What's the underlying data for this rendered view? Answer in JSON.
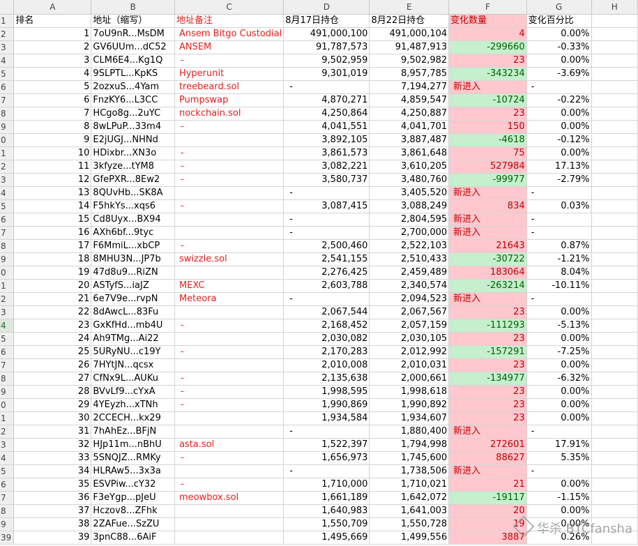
{
  "columns": [
    "A",
    "B",
    "C",
    "D",
    "E",
    "F",
    "G",
    "H"
  ],
  "headers": {
    "rank": "排名",
    "address": "地址（缩写）",
    "note": "地址备注",
    "hold_aug17": "8月17日持仓",
    "hold_aug22": "8月22日持仓",
    "change_qty": "变化数量",
    "change_pct": "变化百分比"
  },
  "row_numbers": [
    "1",
    "2",
    "3",
    "4",
    "5",
    "6",
    "7",
    "8",
    "9",
    "0",
    "1",
    "2",
    "3",
    "4",
    "5",
    "6",
    "7",
    "8",
    "9",
    "0",
    "1",
    "2",
    "3",
    "4",
    "5",
    "6",
    "7",
    "8",
    "9",
    "0",
    "1",
    "2",
    "3",
    "4",
    "5",
    "6",
    "7",
    "8",
    "9",
    "39"
  ],
  "selected_row": "4",
  "rows": [
    {
      "rank": "1",
      "address": "7oU9nR...MsDM",
      "note": "Ansem Bitgo Custodial",
      "aug17": "491,000,100",
      "aug22": "491,000,104",
      "change": "4",
      "change_type": "pos",
      "pct": "0.00%"
    },
    {
      "rank": "2",
      "address": "GV6UUm...dC52",
      "note": "ANSEM",
      "aug17": "91,787,573",
      "aug22": "91,487,913",
      "change": "-299660",
      "change_type": "neg",
      "pct": "-0.33%"
    },
    {
      "rank": "3",
      "address": "CLM6E4...Kg1Q",
      "note": "-",
      "aug17": "9,502,959",
      "aug22": "9,502,982",
      "change": "23",
      "change_type": "pos",
      "pct": "0.00%"
    },
    {
      "rank": "4",
      "address": "9SLPTL...KpKS",
      "note": "Hyperunit",
      "aug17": "9,301,019",
      "aug22": "8,957,785",
      "change": "-343234",
      "change_type": "neg",
      "pct": "-3.69%"
    },
    {
      "rank": "5",
      "address": "2ozxuS...4Yam",
      "note": "treebeard.sol",
      "aug17": "-",
      "aug22": "7,194,277",
      "change": "新进入",
      "change_type": "new",
      "pct": "-"
    },
    {
      "rank": "6",
      "address": "FnzKY6...L3CC",
      "note": "Pumpswap",
      "aug17": "4,870,271",
      "aug22": "4,859,547",
      "change": "-10724",
      "change_type": "neg",
      "pct": "-0.22%"
    },
    {
      "rank": "7",
      "address": "HCgo8g...2uYC",
      "note": "nockchain.sol",
      "aug17": "4,250,864",
      "aug22": "4,250,887",
      "change": "23",
      "change_type": "pos",
      "pct": "0.00%"
    },
    {
      "rank": "8",
      "address": "8wLPuP...33m4",
      "note": "-",
      "aug17": "4,041,551",
      "aug22": "4,041,701",
      "change": "150",
      "change_type": "pos",
      "pct": "0.00%"
    },
    {
      "rank": "9",
      "address": "E2jUGJ...NHNd",
      "note": "",
      "aug17": "3,892,105",
      "aug22": "3,887,487",
      "change": "-4618",
      "change_type": "neg",
      "pct": "-0.12%"
    },
    {
      "rank": "10",
      "address": "HDixbr...XN3o",
      "note": "-",
      "aug17": "3,861,573",
      "aug22": "3,861,648",
      "change": "75",
      "change_type": "pos",
      "pct": "0.00%"
    },
    {
      "rank": "11",
      "address": "3kfyze...tYM8",
      "note": "-",
      "aug17": "3,082,221",
      "aug22": "3,610,205",
      "change": "527984",
      "change_type": "pos",
      "pct": "17.13%"
    },
    {
      "rank": "12",
      "address": "GfePXR...8Ew2",
      "note": "-",
      "aug17": "3,580,737",
      "aug22": "3,480,760",
      "change": "-99977",
      "change_type": "neg",
      "pct": "-2.79%"
    },
    {
      "rank": "13",
      "address": "8QUvHb...SK8A",
      "note": "",
      "aug17": "-",
      "aug22": "3,405,520",
      "change": "新进入",
      "change_type": "new",
      "pct": "-"
    },
    {
      "rank": "14",
      "address": "F5hkYs...xqs6",
      "note": "-",
      "aug17": "3,087,415",
      "aug22": "3,088,249",
      "change": "834",
      "change_type": "pos",
      "pct": "0.03%"
    },
    {
      "rank": "15",
      "address": "Cd8Uyx...BX94",
      "note": "",
      "aug17": "-",
      "aug22": "2,804,595",
      "change": "新进入",
      "change_type": "new",
      "pct": "-"
    },
    {
      "rank": "16",
      "address": "AXh6bf...9tyc",
      "note": "",
      "aug17": "-",
      "aug22": "2,700,000",
      "change": "新进入",
      "change_type": "new",
      "pct": "-"
    },
    {
      "rank": "17",
      "address": "F6MmiL...xbCP",
      "note": "-",
      "aug17": "2,500,460",
      "aug22": "2,522,103",
      "change": "21643",
      "change_type": "pos",
      "pct": "0.87%"
    },
    {
      "rank": "18",
      "address": "8MHU3N...JP7b",
      "note": "swizzle.sol",
      "aug17": "2,541,155",
      "aug22": "2,510,433",
      "change": "-30722",
      "change_type": "neg",
      "pct": "-1.21%"
    },
    {
      "rank": "19",
      "address": "47d8u9...RiZN",
      "note": "",
      "aug17": "2,276,425",
      "aug22": "2,459,489",
      "change": "183064",
      "change_type": "pos",
      "pct": "8.04%"
    },
    {
      "rank": "20",
      "address": "ASTyfS...iaJZ",
      "note": "MEXC",
      "aug17": "2,603,788",
      "aug22": "2,340,574",
      "change": "-263214",
      "change_type": "neg",
      "pct": "-10.11%"
    },
    {
      "rank": "21",
      "address": "6e7V9e...rvpN",
      "note": "Meteora",
      "aug17": "-",
      "aug22": "2,094,523",
      "change": "新进入",
      "change_type": "new",
      "pct": "-"
    },
    {
      "rank": "22",
      "address": "8dAwcL...83Fu",
      "note": "",
      "aug17": "2,067,544",
      "aug22": "2,067,567",
      "change": "23",
      "change_type": "pos",
      "pct": "0.00%"
    },
    {
      "rank": "23",
      "address": "GxKfHd...mb4U",
      "note": "-",
      "aug17": "2,168,452",
      "aug22": "2,057,159",
      "change": "-111293",
      "change_type": "neg",
      "pct": "-5.13%"
    },
    {
      "rank": "24",
      "address": "Ah9TMg...Ai22",
      "note": "",
      "aug17": "2,030,082",
      "aug22": "2,030,105",
      "change": "23",
      "change_type": "pos",
      "pct": "0.00%"
    },
    {
      "rank": "25",
      "address": "5URyNU...c19Y",
      "note": "-",
      "aug17": "2,170,283",
      "aug22": "2,012,992",
      "change": "-157291",
      "change_type": "neg",
      "pct": "-7.25%"
    },
    {
      "rank": "26",
      "address": "7HYtJN...qcsx",
      "note": "",
      "aug17": "2,010,008",
      "aug22": "2,010,031",
      "change": "23",
      "change_type": "pos",
      "pct": "0.00%"
    },
    {
      "rank": "27",
      "address": "CfNx9L...AUKu",
      "note": "-",
      "aug17": "2,135,638",
      "aug22": "2,000,661",
      "change": "-134977",
      "change_type": "neg",
      "pct": "-6.32%"
    },
    {
      "rank": "28",
      "address": "BVvLf9...cYxA",
      "note": "-",
      "aug17": "1,998,595",
      "aug22": "1,998,618",
      "change": "23",
      "change_type": "pos",
      "pct": "0.00%"
    },
    {
      "rank": "29",
      "address": "4YEyzh...xTNh",
      "note": "-",
      "aug17": "1,990,869",
      "aug22": "1,990,892",
      "change": "23",
      "change_type": "pos",
      "pct": "0.00%"
    },
    {
      "rank": "30",
      "address": "2CCECH...kx29",
      "note": "",
      "aug17": "1,934,584",
      "aug22": "1,934,607",
      "change": "23",
      "change_type": "pos",
      "pct": "0.00%"
    },
    {
      "rank": "31",
      "address": "7hAhEz...BFjN",
      "note": "",
      "aug17": "-",
      "aug22": "1,880,400",
      "change": "新进入",
      "change_type": "new",
      "pct": "-"
    },
    {
      "rank": "32",
      "address": "HJp11m...nBhU",
      "note": "asta.sol",
      "aug17": "1,522,397",
      "aug22": "1,794,998",
      "change": "272601",
      "change_type": "pos",
      "pct": "17.91%"
    },
    {
      "rank": "33",
      "address": "5SNQJZ...RMKy",
      "note": "-",
      "aug17": "1,656,973",
      "aug22": "1,745,600",
      "change": "88627",
      "change_type": "pos",
      "pct": "5.35%"
    },
    {
      "rank": "34",
      "address": "HLRAw5...3x3a",
      "note": "",
      "aug17": "-",
      "aug22": "1,738,506",
      "change": "新进入",
      "change_type": "new",
      "pct": "-"
    },
    {
      "rank": "35",
      "address": "ESVPiw...cY32",
      "note": "-",
      "aug17": "1,710,000",
      "aug22": "1,710,021",
      "change": "21",
      "change_type": "pos",
      "pct": "0.00%"
    },
    {
      "rank": "36",
      "address": "F3eYgp...pJeU",
      "note": "meowbox.sol",
      "aug17": "1,661,189",
      "aug22": "1,642,072",
      "change": "-19117",
      "change_type": "neg",
      "pct": "-1.15%"
    },
    {
      "rank": "37",
      "address": "Hczov8...ZFhk",
      "note": "",
      "aug17": "1,640,983",
      "aug22": "1,641,003",
      "change": "20",
      "change_type": "pos",
      "pct": "0.00%"
    },
    {
      "rank": "38",
      "address": "2ZAFue...SzZU",
      "note": "",
      "aug17": "1,550,709",
      "aug22": "1,550,728",
      "change": "19",
      "change_type": "pos",
      "pct": "0.00%"
    },
    {
      "rank": "39",
      "address": "3pnC88...6AiF",
      "note": "",
      "aug17": "1,495,669",
      "aug22": "1,499,556",
      "change": "3887",
      "change_type": "pos",
      "pct": "0.26%"
    }
  ],
  "watermark": "华杀 BTCfansha",
  "colors": {
    "positive_fill": "#ffc7ce",
    "positive_text": "#c00000",
    "negative_fill": "#c6efce",
    "negative_text": "#006100",
    "note_text": "#e02020"
  }
}
